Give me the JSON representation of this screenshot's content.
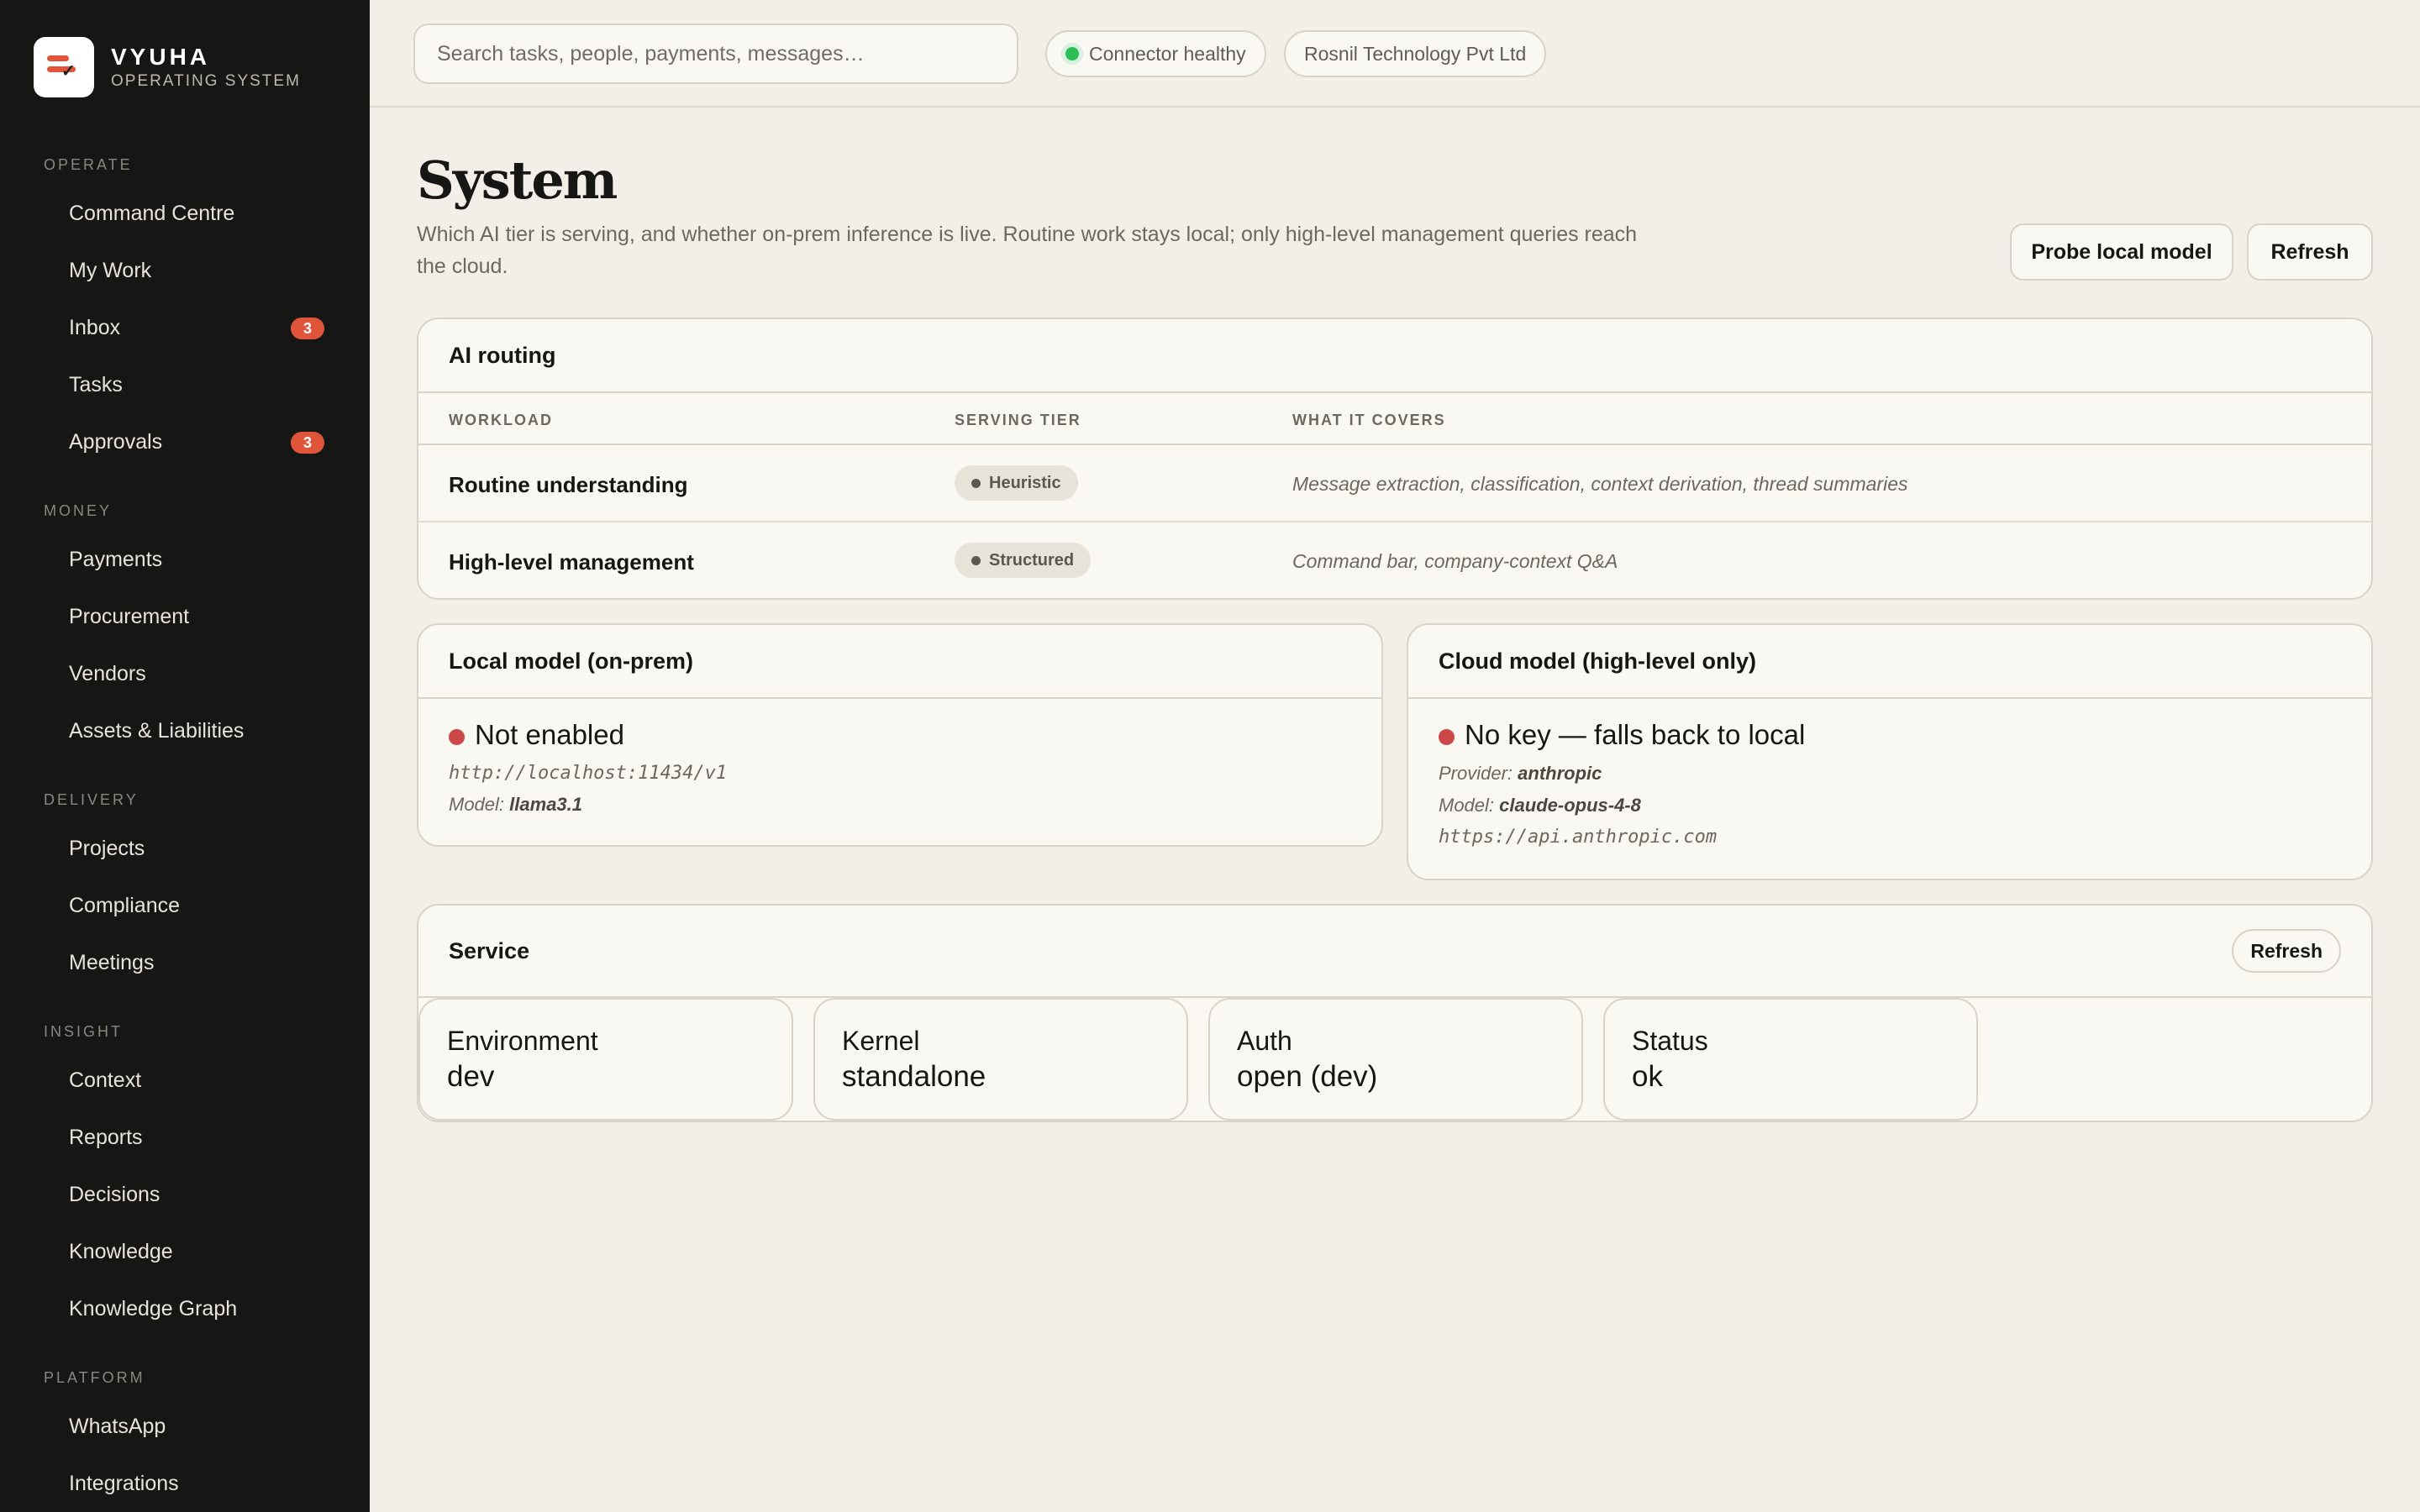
{
  "brand": {
    "name": "VYUHA",
    "subtitle": "OPERATING SYSTEM"
  },
  "sidebar": {
    "sections": [
      {
        "title": "OPERATE",
        "items": [
          {
            "label": "Command Centre"
          },
          {
            "label": "My Work"
          },
          {
            "label": "Inbox",
            "badge": "3"
          },
          {
            "label": "Tasks"
          },
          {
            "label": "Approvals",
            "badge": "3"
          }
        ]
      },
      {
        "title": "MONEY",
        "items": [
          {
            "label": "Payments"
          },
          {
            "label": "Procurement"
          },
          {
            "label": "Vendors"
          },
          {
            "label": "Assets & Liabilities"
          }
        ]
      },
      {
        "title": "DELIVERY",
        "items": [
          {
            "label": "Projects"
          },
          {
            "label": "Compliance"
          },
          {
            "label": "Meetings"
          }
        ]
      },
      {
        "title": "INSIGHT",
        "items": [
          {
            "label": "Context"
          },
          {
            "label": "Reports"
          },
          {
            "label": "Decisions"
          },
          {
            "label": "Knowledge"
          },
          {
            "label": "Knowledge Graph"
          }
        ]
      },
      {
        "title": "PLATFORM",
        "items": [
          {
            "label": "WhatsApp"
          },
          {
            "label": "Integrations"
          }
        ]
      }
    ]
  },
  "topbar": {
    "search_placeholder": "Search tasks, people, payments, messages…",
    "connector_status": "Connector healthy",
    "connector_color": "#2dbd55",
    "company": "Rosnil Technology Pvt Ltd"
  },
  "page": {
    "title": "System",
    "description": "Which AI tier is serving, and whether on-prem inference is live. Routine work stays local; only high-level management queries reach the cloud.",
    "probe_button": "Probe local model",
    "refresh_button": "Refresh"
  },
  "routing": {
    "title": "AI routing",
    "columns": [
      "WORKLOAD",
      "SERVING TIER",
      "WHAT IT COVERS"
    ],
    "rows": [
      {
        "workload": "Routine understanding",
        "tier": "Heuristic",
        "covers": "Message extraction, classification, context derivation, thread summaries"
      },
      {
        "workload": "High-level management",
        "tier": "Structured",
        "covers": "Command bar, company-context Q&A"
      }
    ]
  },
  "local_model": {
    "title": "Local model (on-prem)",
    "status": "Not enabled",
    "status_color": "#cc4848",
    "url": "http://localhost:11434/v1",
    "model_label": "Model:",
    "model": "llama3.1"
  },
  "cloud_model": {
    "title": "Cloud model (high-level only)",
    "status": "No key — falls back to local",
    "status_color": "#cc4848",
    "provider_label": "Provider:",
    "provider": "anthropic",
    "model_label": "Model:",
    "model": "claude-opus-4-8",
    "url": "https://api.anthropic.com"
  },
  "service": {
    "title": "Service",
    "refresh_button": "Refresh",
    "items": [
      {
        "label": "Environment",
        "value": "dev"
      },
      {
        "label": "Kernel",
        "value": "standalone"
      },
      {
        "label": "Auth",
        "value": "open (dev)"
      },
      {
        "label": "Status",
        "value": "ok"
      }
    ]
  }
}
